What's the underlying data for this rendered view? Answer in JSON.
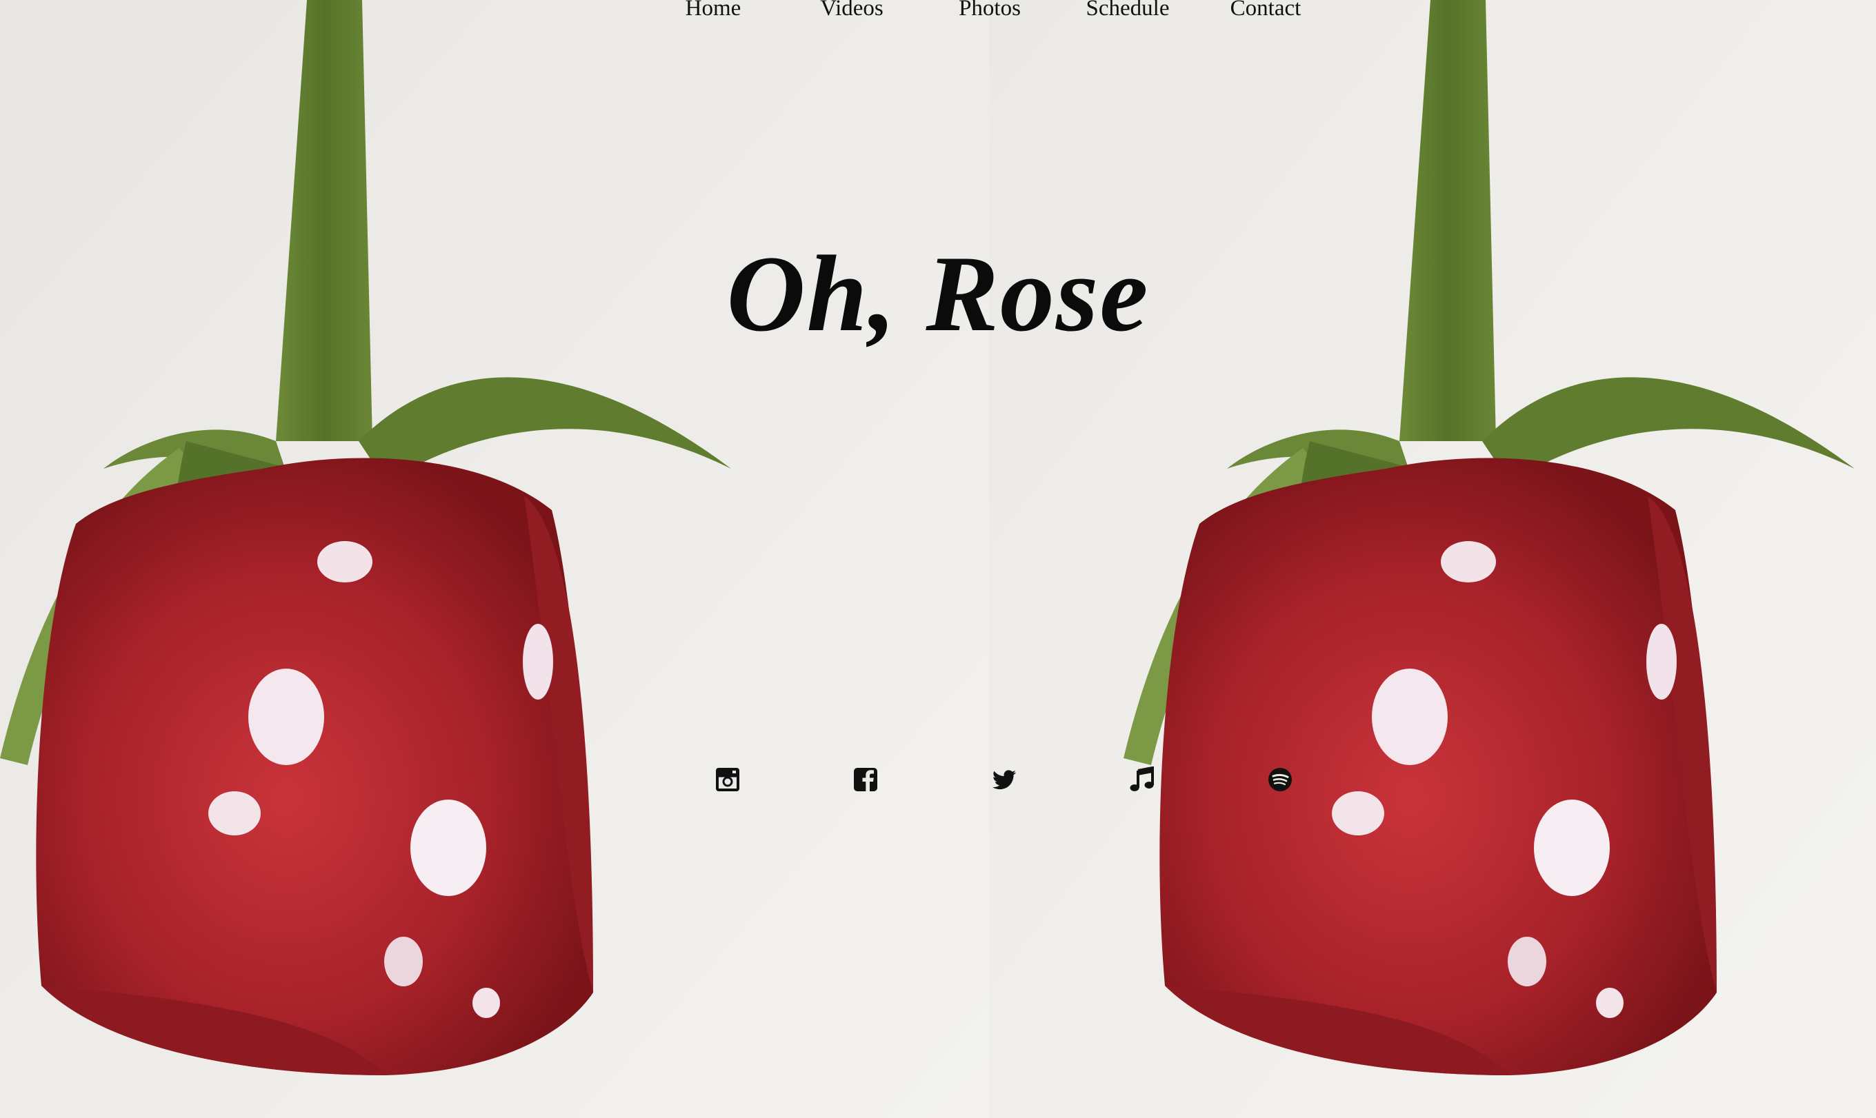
{
  "nav": {
    "items": [
      {
        "label": "Home"
      },
      {
        "label": "Videos"
      },
      {
        "label": "Photos"
      },
      {
        "label": "Schedule"
      },
      {
        "label": "Contact"
      }
    ]
  },
  "hero": {
    "title": "Oh, Rose"
  },
  "social": {
    "icons": [
      "instagram-icon",
      "facebook-icon",
      "twitter-icon",
      "music-note-icon",
      "spotify-icon"
    ]
  },
  "colors": {
    "text": "#111111",
    "background": "#eceae6",
    "rose_red": "#b3262b",
    "stem_green": "#5e7a32"
  }
}
